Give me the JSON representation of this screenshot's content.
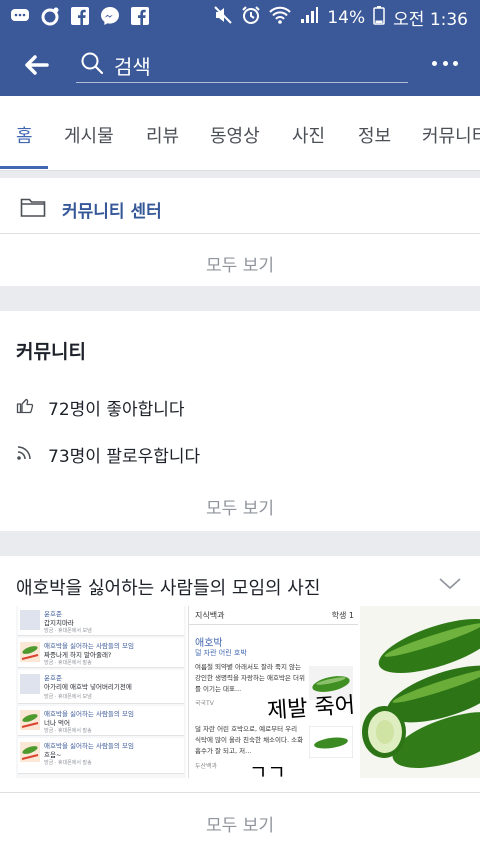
{
  "status_bar": {
    "battery": "14%",
    "time": "오전 1:36"
  },
  "app_bar": {
    "search_placeholder": "검색"
  },
  "tabs": [
    "홈",
    "게시물",
    "리뷰",
    "동영상",
    "사진",
    "정보",
    "커뮤니티"
  ],
  "active_tab": "홈",
  "community_center": {
    "label": "커뮤니티 센터",
    "see_all": "모두 보기"
  },
  "community": {
    "title": "커뮤니티",
    "likes": "72명이 좋아합니다",
    "follows": "73명이 팔로우합니다",
    "see_all": "모두 보기"
  },
  "photos_section": {
    "title": "애호박을 싫어하는 사람들의 모임의 사진",
    "see_all": "모두 보기",
    "thumb1_rows": [
      {
        "name": "윤호준",
        "msg": "갑지치마라",
        "meta": "방금 · 휴대폰에서 보냄"
      },
      {
        "name": "애호박을 싫어하는 사람들의 모임",
        "msg": "짜증나게 하지 말아줄래?",
        "meta": "방금 · 휴대폰에서 발송"
      },
      {
        "name": "윤호준",
        "msg": "아가리에 애호박 넣어버리기전에",
        "meta": "방금 · 휴대폰에서 보냄"
      },
      {
        "name": "애호박을 싫어하는 사람들의 모임",
        "msg": "너나 먹어",
        "meta": "방금 · 휴대폰에서 발송"
      },
      {
        "name": "애호박을 싫어하는 사람들의 모임",
        "msg": "흐음~",
        "meta": "방금 · 휴대폰에서 발송"
      }
    ],
    "thumb2": {
      "header": "지식백과",
      "header_right": "학생 1",
      "title": "애호박",
      "subtitle": "덜 자란 어린 호박",
      "body1": "여름철 뙤약볕 아래서도 잘라 죽지 않는 강인한 생명력을 자랑하는 애호박은 더위를 이기는 대표...",
      "source1": "국국TV",
      "body2": "덜 자란 어린 호박으로, 예로부터 우리 식탁에 많이 올라 친숙한 채소이다. 소화흡수가 잘 되고, 저...",
      "source2": "두산백과",
      "handwriting1": "제발 죽어",
      "handwriting2": "ㄱㄱ"
    }
  }
}
